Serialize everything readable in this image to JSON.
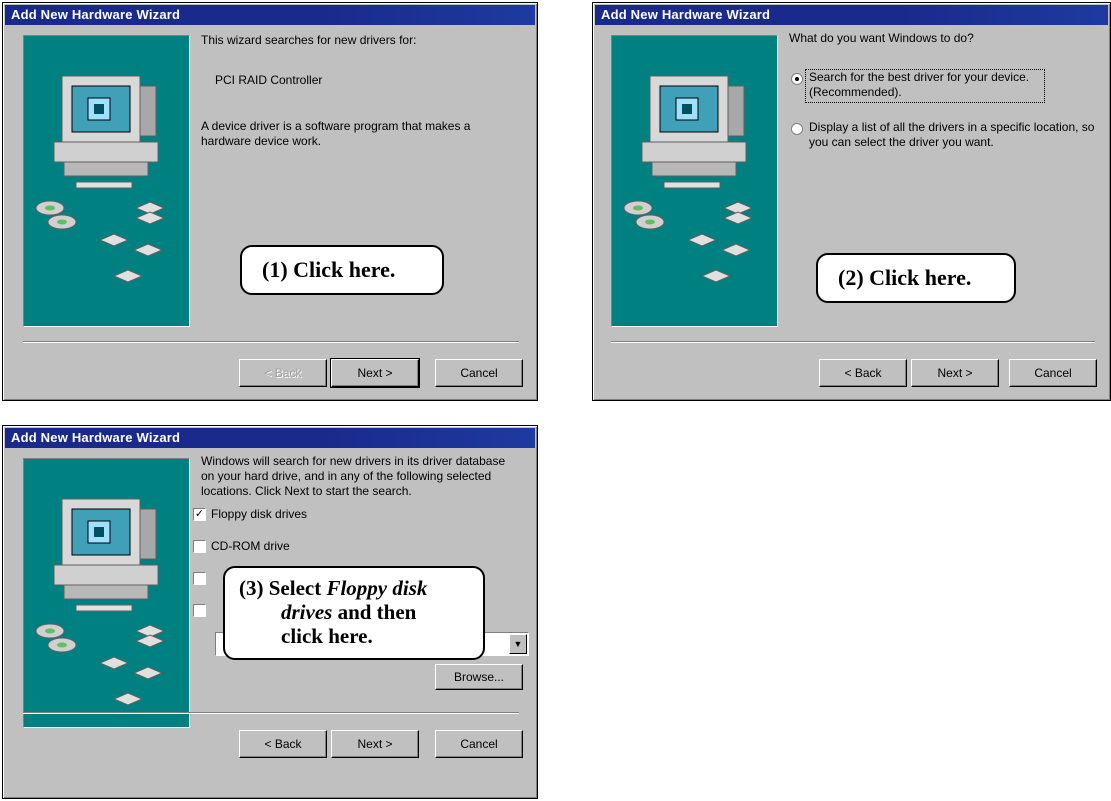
{
  "dialog1": {
    "title": "Add New Hardware Wizard",
    "intro": "This wizard searches for new drivers for:",
    "device": "PCI RAID Controller",
    "description": "A device driver is a software program that makes a hardware device work.",
    "callout": "(1)  Click here.",
    "buttons": {
      "back": "< Back",
      "next": "Next >",
      "cancel": "Cancel"
    }
  },
  "dialog2": {
    "title": "Add New Hardware Wizard",
    "question": "What do you want Windows to do?",
    "option1": "Search for the best driver for your device. (Recommended).",
    "option1_selected": true,
    "option2": "Display a list of all the drivers in a specific location, so you can select the driver you want.",
    "option2_selected": false,
    "callout": "(2)  Click here.",
    "buttons": {
      "back": "< Back",
      "next": "Next >",
      "cancel": "Cancel"
    }
  },
  "dialog3": {
    "title": "Add New Hardware Wizard",
    "intro": "Windows will search for new drivers in its driver database on your hard drive, and in any of the following selected locations. Click Next to start the search.",
    "floppy_label": "Floppy disk drives",
    "floppy_checked": true,
    "cdrom_label": "CD-ROM drive",
    "cdrom_checked": false,
    "browse": "Browse...",
    "callout_line1": "(3)  Select ",
    "callout_em1": "Floppy disk",
    "callout_em2": "drives",
    "callout_line2": " and then",
    "callout_line3": "click here.",
    "buttons": {
      "back": "< Back",
      "next": "Next >",
      "cancel": "Cancel"
    }
  },
  "colors": {
    "titlebar": "#1a2a8c",
    "panel": "#008080",
    "face": "#c0c0c0"
  }
}
